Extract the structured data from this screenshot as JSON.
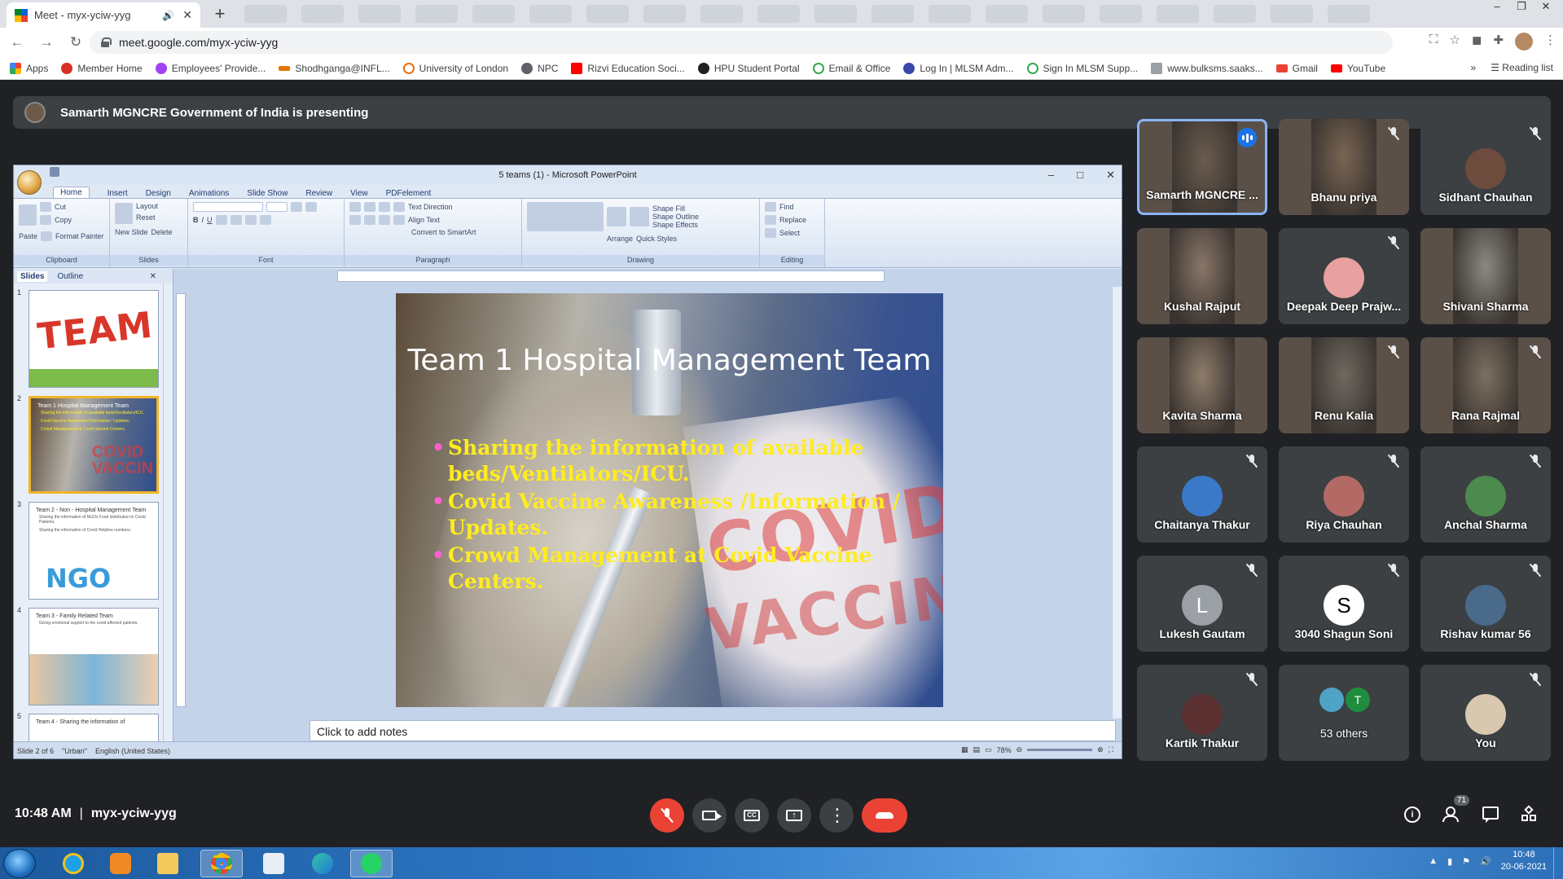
{
  "browser": {
    "tab_title": "Meet - myx-yciw-yyg",
    "url": "meet.google.com/myx-yciw-yyg",
    "bookmarks": [
      {
        "label": "Apps",
        "color": "#4285f4"
      },
      {
        "label": "Member Home",
        "color": "#d93025"
      },
      {
        "label": "Employees' Provide...",
        "color": "#a142f4"
      },
      {
        "label": "Shodhganga@INFL...",
        "color": "#e37400"
      },
      {
        "label": "University of London",
        "color": "#e8710a"
      },
      {
        "label": "NPC",
        "color": "#5f6368"
      },
      {
        "label": "Rizvi Education Soci...",
        "color": "#ff0000"
      },
      {
        "label": "HPU Student Portal",
        "color": "#202124"
      },
      {
        "label": "Email & Office",
        "color": "#34a853"
      },
      {
        "label": "Log In | MLSM Adm...",
        "color": "#3949ab"
      },
      {
        "label": "Sign In MLSM Supp...",
        "color": "#34a853"
      },
      {
        "label": "www.bulksms.saaks...",
        "color": "#9aa0a6"
      },
      {
        "label": "Gmail",
        "color": "#ea4335"
      },
      {
        "label": "YouTube",
        "color": "#ff0000"
      }
    ],
    "bookmarks_more": "»",
    "reading_list": "Reading list"
  },
  "meet": {
    "presenting_text": "Samarth MGNCRE Government of India is presenting",
    "time": "10:48 AM",
    "meeting_code": "myx-yciw-yyg",
    "people_count": "71",
    "participants": [
      {
        "name": "Samarth MGNCRE ...",
        "type": "video",
        "active": true,
        "muted": false,
        "color": "#6b5c4e"
      },
      {
        "name": "Bhanu priya",
        "type": "video",
        "active": false,
        "muted": true,
        "color": "#7a6552"
      },
      {
        "name": "Sidhant Chauhan",
        "type": "avatar",
        "active": false,
        "muted": true,
        "color": "#6d4c3d",
        "initial": ""
      },
      {
        "name": "Kushal Rajput",
        "type": "video",
        "active": false,
        "muted": false,
        "color": "#8a7668"
      },
      {
        "name": "Deepak Deep Prajw...",
        "type": "avatar",
        "active": false,
        "muted": true,
        "color": "#e8a0a0",
        "initial": ""
      },
      {
        "name": "Shivani Sharma",
        "type": "video",
        "active": false,
        "muted": false,
        "color": "#8b8a80"
      },
      {
        "name": "Kavita Sharma",
        "type": "video",
        "active": false,
        "muted": false,
        "color": "#8f7d6b"
      },
      {
        "name": "Renu Kalia",
        "type": "video",
        "active": false,
        "muted": true,
        "color": "#6f6a60"
      },
      {
        "name": "Rana Rajmal",
        "type": "video",
        "active": false,
        "muted": true,
        "color": "#7d7060"
      },
      {
        "name": "Chaitanya Thakur",
        "type": "avatar",
        "active": false,
        "muted": true,
        "color": "#3a79c8",
        "initial": ""
      },
      {
        "name": "Riya Chauhan",
        "type": "avatar",
        "active": false,
        "muted": true,
        "color": "#b46a64",
        "initial": ""
      },
      {
        "name": "Anchal Sharma",
        "type": "avatar",
        "active": false,
        "muted": true,
        "color": "#4d8a4e",
        "initial": ""
      },
      {
        "name": "Lukesh Gautam",
        "type": "avatar",
        "active": false,
        "muted": true,
        "color": "#9aa0a6",
        "initial": "L"
      },
      {
        "name": "3040 Shagun Soni",
        "type": "avatar",
        "active": false,
        "muted": true,
        "color": "#ffffff",
        "initial": "S"
      },
      {
        "name": "Rishav kumar 56",
        "type": "avatar",
        "active": false,
        "muted": true,
        "color": "#4a6a8a",
        "initial": ""
      },
      {
        "name": "Kartik Thakur",
        "type": "avatar",
        "active": false,
        "muted": true,
        "color": "#5a3030",
        "initial": ""
      },
      {
        "name": "53 others",
        "type": "others",
        "active": false,
        "muted": false,
        "color": "#3c4043",
        "initial": "T"
      },
      {
        "name": "You",
        "type": "avatar",
        "active": false,
        "muted": true,
        "color": "#d9c8b0",
        "initial": ""
      }
    ]
  },
  "powerpoint": {
    "window_title": "5 teams (1) - Microsoft PowerPoint",
    "ribbon_tabs": [
      "Home",
      "Insert",
      "Design",
      "Animations",
      "Slide Show",
      "Review",
      "View",
      "PDFelement"
    ],
    "ribbon_groups": {
      "clipboard": {
        "label": "Clipboard",
        "paste": "Paste",
        "cut": "Cut",
        "copy": "Copy",
        "format_painter": "Format Painter"
      },
      "slides": {
        "label": "Slides",
        "new_slide": "New Slide",
        "layout": "Layout",
        "reset": "Reset",
        "delete": "Delete"
      },
      "font": {
        "label": "Font"
      },
      "paragraph": {
        "label": "Paragraph",
        "text_direction": "Text Direction",
        "align_text": "Align Text",
        "convert": "Convert to SmartArt"
      },
      "drawing": {
        "label": "Drawing",
        "arrange": "Arrange",
        "quick_styles": "Quick Styles",
        "shape_fill": "Shape Fill",
        "shape_outline": "Shape Outline",
        "shape_effects": "Shape Effects"
      },
      "editing": {
        "label": "Editing",
        "find": "Find",
        "replace": "Replace",
        "select": "Select"
      }
    },
    "pane_tabs": [
      "Slides",
      "Outline"
    ],
    "thumbnails": [
      {
        "num": "1",
        "title": "TEAM",
        "body": []
      },
      {
        "num": "2",
        "title": "Team 1 Hospital Management Team",
        "body": [
          "Sharing the information of available beds/Ventilators/ICU.",
          "Covid Vaccine Awareness /Information / Updates.",
          "Crowd Management at Covid Vaccine Centers."
        ]
      },
      {
        "num": "3",
        "title": "Team 2 - Non - Hospital Management Team",
        "body": [
          "Sharing the information of NGOs Food distribution to Covid Patients.",
          "Sharing the information of Covid Helpline numbers."
        ],
        "graphic": "NGO"
      },
      {
        "num": "4",
        "title": "Team 3 - Family Related Team",
        "body": [
          "Giving emotional support to the covid affected patients."
        ]
      },
      {
        "num": "5",
        "title": "Team 4 - Sharing the information of",
        "body": []
      }
    ],
    "slide": {
      "title": "Team 1 Hospital Management Team",
      "bullets": [
        "Sharing the information of available beds/Ventilators/ICU.",
        "Covid Vaccine Awareness /Information / Updates.",
        "Crowd Management at Covid Vaccine Centers."
      ],
      "bg_text_1": "COVID",
      "bg_text_2": "VACCIN"
    },
    "notes_placeholder": "Click to add notes",
    "status": {
      "slide": "Slide 2 of 6",
      "theme": "\"Urban\"",
      "language": "English (United States)",
      "zoom": "78%"
    }
  },
  "taskbar": {
    "time": "10:48",
    "date": "20-06-2021"
  }
}
